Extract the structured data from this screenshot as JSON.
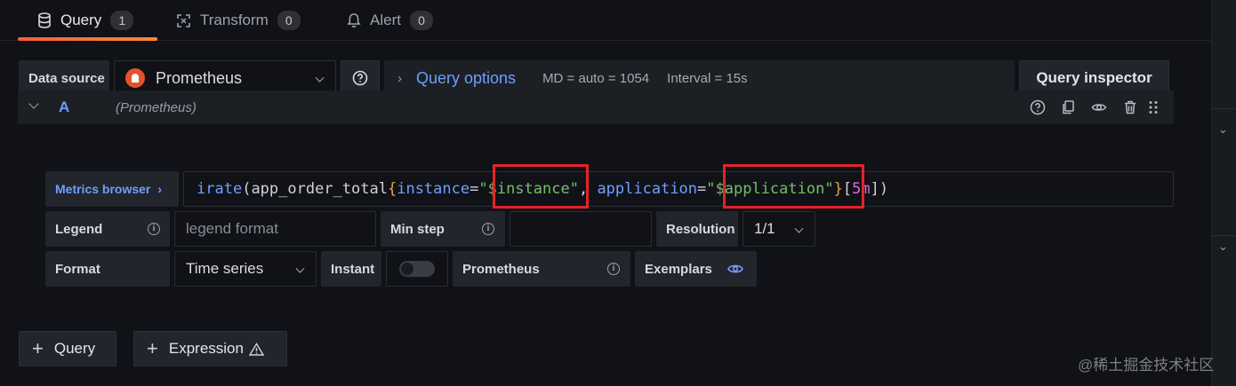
{
  "tabs": [
    {
      "label": "Query",
      "count": "1",
      "active": true,
      "icon": "database-icon"
    },
    {
      "label": "Transform",
      "count": "0",
      "active": false,
      "icon": "transform-icon"
    },
    {
      "label": "Alert",
      "count": "0",
      "active": false,
      "icon": "bell-icon"
    }
  ],
  "toolbar": {
    "data_source_label": "Data source",
    "data_source_value": "Prometheus",
    "query_options_title": "Query options",
    "md": "MD = auto = 1054",
    "interval": "Interval = 15s",
    "query_inspector": "Query inspector"
  },
  "query": {
    "ref_id": "A",
    "datasource_name": "(Prometheus)",
    "metrics_browser": "Metrics browser",
    "expr_tokens": {
      "fn": "irate",
      "open_paren": "(",
      "metric": "app_order_total",
      "open_brace": "{",
      "label1": "instance",
      "eq1": "=",
      "val1": "\"$instance\"",
      "comma": ", ",
      "label2": "application",
      "eq2": "=",
      "val2": "\"$application\"",
      "close_brace": "}",
      "range_open": "[",
      "range": "5m",
      "range_close": "]",
      "close_paren": ")"
    },
    "legend_label": "Legend",
    "legend_placeholder": "legend format",
    "min_step_label": "Min step",
    "min_step_value": "",
    "resolution_label": "Resolution",
    "resolution_value": "1/1",
    "format_label": "Format",
    "format_value": "Time series",
    "instant_label": "Instant",
    "instant_enabled": false,
    "prometheus_label": "Prometheus",
    "exemplars_label": "Exemplars"
  },
  "bottom": {
    "add_query": "Query",
    "add_expression": "Expression",
    "expression_warning_icon": "warning-icon"
  },
  "watermark": "@稀土掘金技术社区",
  "colors": {
    "accent_blue": "#6e9fff",
    "tab_underline": "#f55f3e",
    "string_green": "#73bf69",
    "highlight_red": "#e5222a"
  }
}
